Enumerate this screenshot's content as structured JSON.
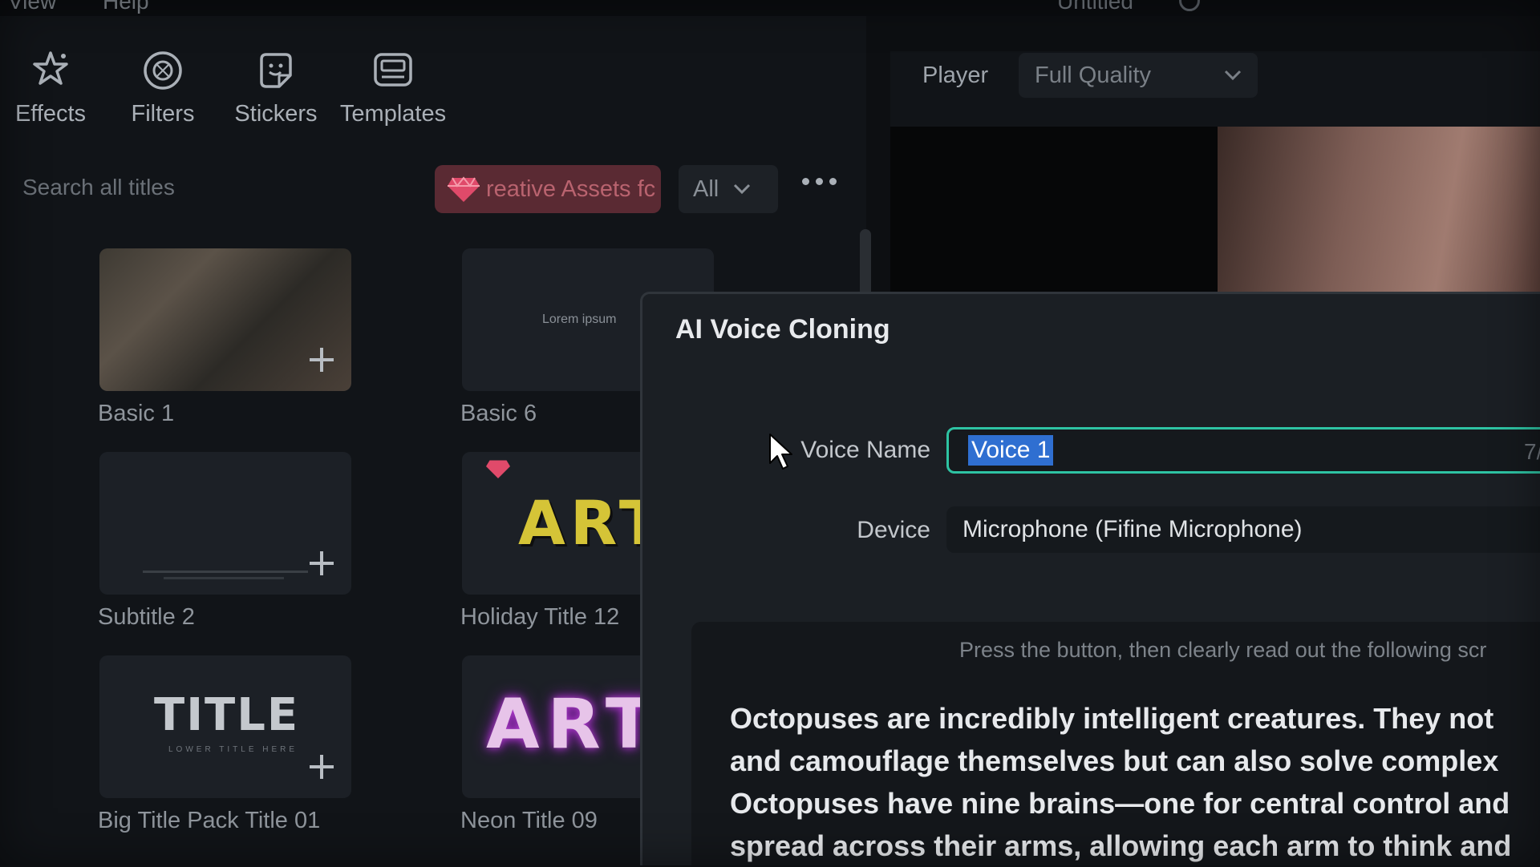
{
  "menubar": {
    "items": [
      "View",
      "Help"
    ],
    "doc_title": "Untitled"
  },
  "toolbar": {
    "tools": [
      {
        "label": "Effects",
        "icon": "effects-icon"
      },
      {
        "label": "Filters",
        "icon": "filters-icon"
      },
      {
        "label": "Stickers",
        "icon": "stickers-icon"
      },
      {
        "label": "Templates",
        "icon": "templates-icon"
      }
    ]
  },
  "titles_panel": {
    "search_placeholder": "Search all titles",
    "assets_label": "reative Assets fc",
    "filter_value": "All",
    "cards": [
      {
        "label": "Basic 1"
      },
      {
        "label": "Basic 6",
        "preview_text": "Lorem ipsum"
      },
      {
        "label": "Subtitle 2"
      },
      {
        "label": "Holiday Title 12",
        "preview_text": "ART"
      },
      {
        "label": "Big Title Pack Title 01",
        "preview_text": "TITLE",
        "preview_sub": "LOWER TITLE HERE"
      },
      {
        "label": "Neon Title 09",
        "preview_text": "ART"
      }
    ]
  },
  "player": {
    "label": "Player",
    "quality": "Full Quality"
  },
  "dialog": {
    "title": "AI Voice Cloning",
    "voice_name_label": "Voice Name",
    "voice_name_value": "Voice 1",
    "voice_name_count": "7/",
    "device_label": "Device",
    "device_value": "Microphone (Fifine  Microphone)",
    "instruction": "Press the button, then clearly read out the following scr",
    "script_lines": [
      "Octopuses are incredibly intelligent creatures. They not",
      "and camouflage themselves but can also solve complex",
      "Octopuses have nine brains—one for central control and",
      "spread across their arms, allowing each arm to think and"
    ]
  },
  "colors": {
    "accent_input_border": "#2ec3a3",
    "selection": "#2f6fd1",
    "premium_gem": "#e04a6a"
  }
}
